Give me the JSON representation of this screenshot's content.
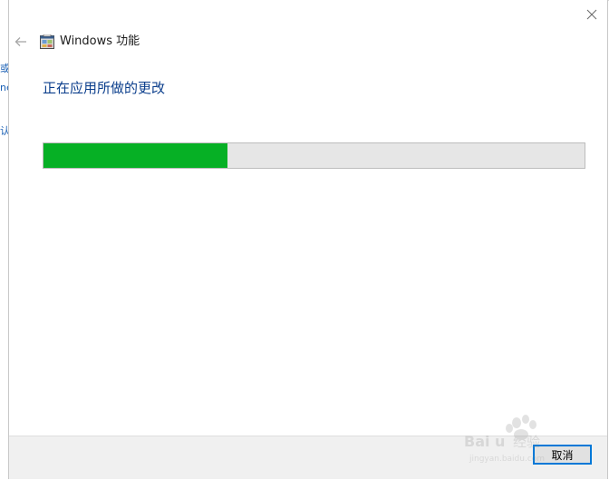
{
  "dialog": {
    "title": "Windows 功能",
    "heading": "正在应用所做的更改",
    "progress": 0.34,
    "cancel_label": "取消",
    "app_icon": "windows-features-icon",
    "back_icon": "back-arrow-icon",
    "close_icon": "close-icon"
  },
  "background_window": {
    "fragments": [
      "或",
      "ne",
      "认"
    ]
  },
  "watermark": {
    "text": "Baidu 经验",
    "subtext": "jingyan.baidu.com"
  },
  "colors": {
    "heading": "#0b3e8c",
    "progress_fill": "#06b025",
    "progress_track": "#e6e6e6",
    "focus_border": "#0078d7",
    "footer_bg": "#f0f0f0"
  }
}
